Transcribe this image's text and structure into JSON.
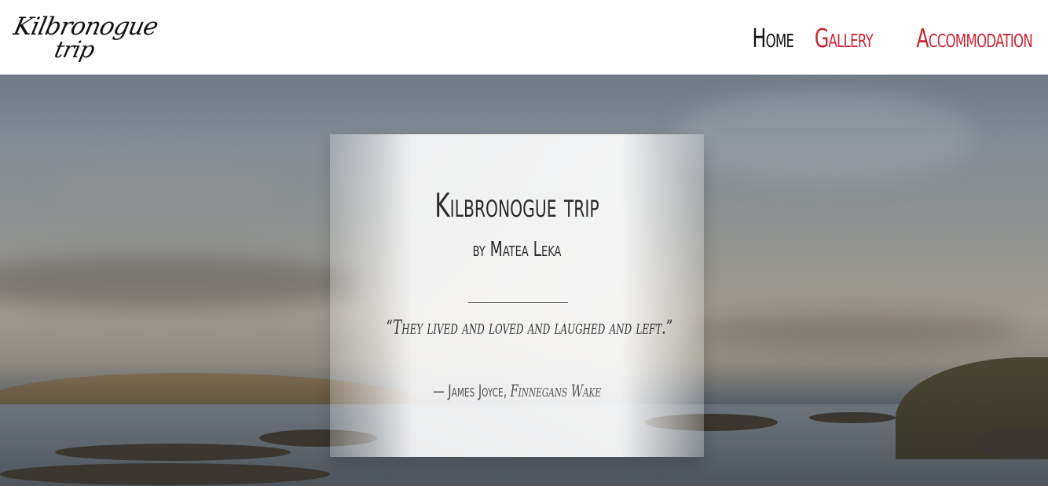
{
  "header": {
    "logo_text_line1": "Kilbronogue",
    "logo_text_line2": "trip",
    "nav": [
      {
        "label": "Home",
        "active": true
      },
      {
        "label": "Gallery",
        "active": false
      },
      {
        "label": "Accommodation",
        "active": false
      }
    ]
  },
  "hero": {
    "title": "Kilbronogue trip",
    "subtitle": "by Matea Leka",
    "quote": "“They lived and loved and laughed and left.”",
    "attribution_author": "— James Joyce,",
    "attribution_book": "Finnegans Wake"
  },
  "colors": {
    "active_nav": "#111111",
    "inactive_nav": "#c8252f"
  }
}
